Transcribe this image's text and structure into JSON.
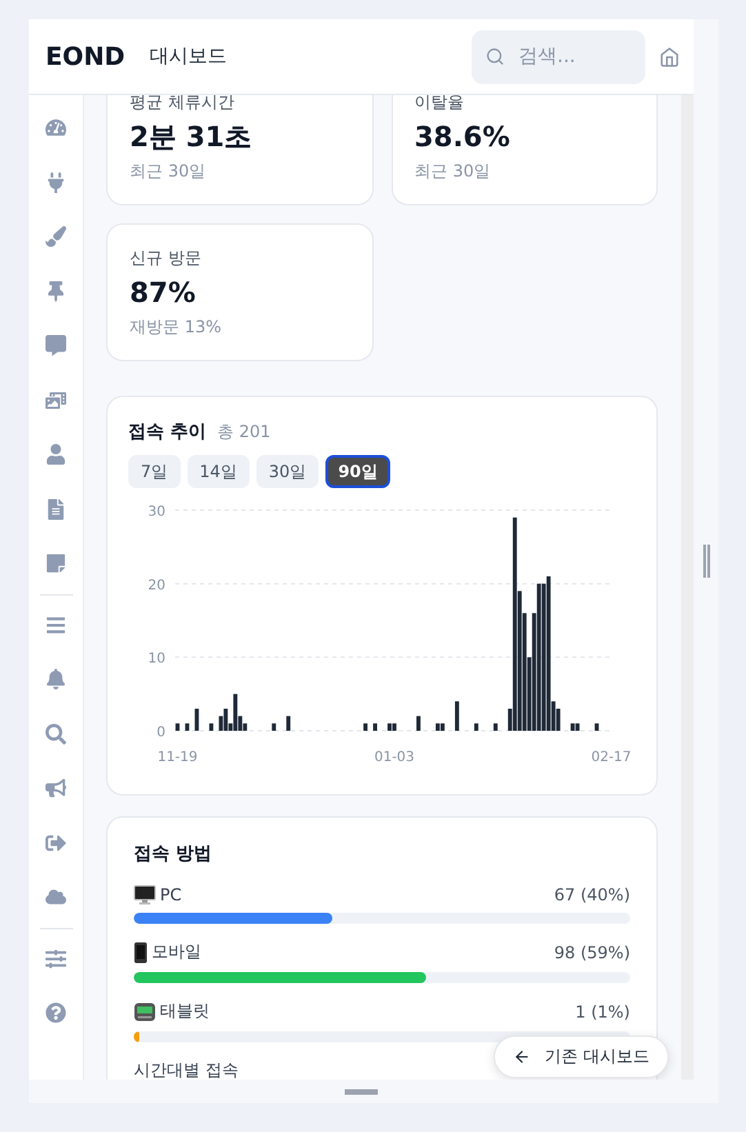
{
  "header": {
    "logo": "EOND",
    "title": "대시보드",
    "search": {
      "placeholder": "검색..."
    }
  },
  "sidebar": {
    "groups": [
      {
        "items": [
          {
            "kind": "gauge"
          },
          {
            "kind": "plug"
          },
          {
            "kind": "brush"
          },
          {
            "kind": "pin"
          },
          {
            "kind": "comment"
          },
          {
            "kind": "media"
          },
          {
            "kind": "user"
          },
          {
            "kind": "document"
          },
          {
            "kind": "note"
          }
        ]
      },
      {
        "items": [
          {
            "kind": "list"
          },
          {
            "kind": "bell"
          },
          {
            "kind": "search"
          },
          {
            "kind": "megaphone"
          },
          {
            "kind": "signout"
          },
          {
            "kind": "cloud"
          }
        ]
      },
      {
        "items": [
          {
            "kind": "sliders"
          },
          {
            "kind": "help"
          }
        ]
      }
    ]
  },
  "stats": [
    {
      "label": "평균 체류시간",
      "value": "2분 31초",
      "sub": "최근 30일"
    },
    {
      "label": "이탈율",
      "value": "38.6%",
      "sub": "최근 30일"
    },
    {
      "label": "신규 방문",
      "value": "87%",
      "sub": "재방문 13%"
    }
  ],
  "trend": {
    "title": "접속 추이",
    "total": "총 201",
    "ranges": [
      {
        "label": "7일",
        "selected": false
      },
      {
        "label": "14일",
        "selected": false
      },
      {
        "label": "30일",
        "selected": false
      },
      {
        "label": "90일",
        "selected": true
      }
    ],
    "chart_data": {
      "type": "bar",
      "categories": [
        "11-19",
        null,
        null,
        null,
        null,
        null,
        null,
        null,
        null,
        null,
        null,
        null,
        null,
        null,
        null,
        null,
        null,
        null,
        null,
        null,
        null,
        null,
        null,
        null,
        null,
        null,
        null,
        null,
        null,
        null,
        null,
        null,
        null,
        null,
        null,
        null,
        null,
        null,
        null,
        null,
        null,
        null,
        null,
        null,
        null,
        "01-03",
        null,
        null,
        null,
        null,
        null,
        null,
        null,
        null,
        null,
        null,
        null,
        null,
        null,
        null,
        null,
        null,
        null,
        null,
        null,
        null,
        null,
        null,
        null,
        null,
        null,
        null,
        null,
        null,
        null,
        null,
        null,
        null,
        null,
        null,
        null,
        null,
        null,
        null,
        null,
        null,
        null,
        null,
        null,
        null,
        "02-17"
      ],
      "values": [
        1,
        0,
        1,
        0,
        3,
        0,
        0,
        1,
        0,
        2,
        3,
        1,
        5,
        2,
        1,
        0,
        0,
        0,
        0,
        0,
        1,
        0,
        0,
        2,
        0,
        0,
        0,
        0,
        0,
        0,
        0,
        0,
        0,
        0,
        0,
        0,
        0,
        0,
        0,
        1,
        0,
        1,
        0,
        0,
        1,
        1,
        0,
        0,
        0,
        0,
        2,
        0,
        0,
        0,
        1,
        1,
        0,
        0,
        4,
        0,
        0,
        0,
        1,
        0,
        0,
        0,
        1,
        0,
        0,
        3,
        29,
        19,
        16,
        10,
        16,
        20,
        20,
        21,
        4,
        3,
        0,
        0,
        1,
        1,
        0,
        0,
        0,
        1,
        0,
        0,
        0
      ],
      "ylim": [
        0,
        30
      ],
      "yticks": [
        0,
        10,
        20,
        30
      ]
    }
  },
  "devices": {
    "title": "접속 방법",
    "items": [
      {
        "kind": "pc",
        "name": "PC",
        "reading": "67 (40%)",
        "level": 0.4,
        "color": "#3b82f6"
      },
      {
        "kind": "mobile",
        "name": "모바일",
        "reading": "98 (59%)",
        "level": 0.59,
        "color": "#22c55e"
      },
      {
        "kind": "tablet",
        "name": "태블릿",
        "reading": "1 (1%)",
        "level": 0.01,
        "color": "#f59e0b"
      }
    ]
  },
  "next_section": {
    "title": "시간대별 접속"
  },
  "floating_button": {
    "label": "기존 대시보드"
  }
}
